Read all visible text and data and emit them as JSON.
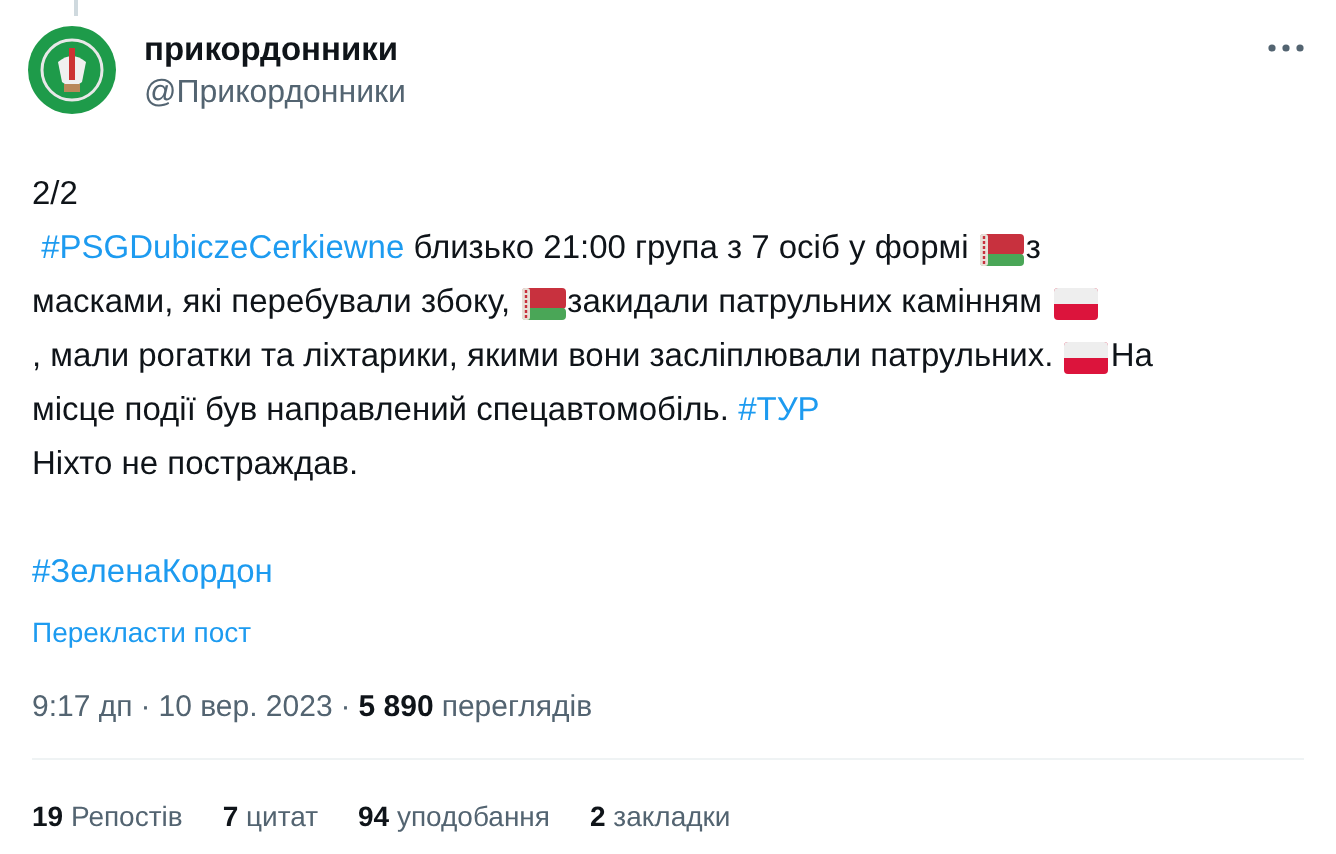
{
  "author": {
    "name": "прикордонники",
    "handle": "@Прикордонники"
  },
  "body": {
    "lines": [
      [
        {
          "kind": "text",
          "text": "2/2"
        }
      ],
      [
        {
          "kind": "hashtag",
          "text": " #PSGDubiczeCerkiewne"
        },
        {
          "kind": "text",
          "text": " близько 21:00 група з 7 осіб у формі "
        },
        {
          "kind": "by_flag"
        },
        {
          "kind": "text",
          "text": "з"
        }
      ],
      [
        {
          "kind": "text",
          "text": "масками, які перебували збоку, "
        },
        {
          "kind": "by_flag"
        },
        {
          "kind": "text",
          "text": "закидали патрульних камінням "
        },
        {
          "kind": "pl_flag"
        }
      ],
      [
        {
          "kind": "text",
          "text": ", мали рогатки та ліхтарики, якими вони засліплювали патрульних. "
        },
        {
          "kind": "pl_flag"
        },
        {
          "kind": "text",
          "text": "На"
        }
      ],
      [
        {
          "kind": "text",
          "text": "місце події був направлений спецавтомобіль. "
        },
        {
          "kind": "hashtag",
          "text": "#ТУР"
        }
      ],
      [
        {
          "kind": "text",
          "text": "Ніхто не постраждав."
        }
      ]
    ],
    "footer_hashtag": "#ЗеленаКордон"
  },
  "translate_link": "Перекласти пост",
  "meta": {
    "time": "9:17 дп",
    "separator_1": "·",
    "date": "10 вер. 2023",
    "separator_2": "·",
    "views_count": "5 890",
    "views_label": "переглядів"
  },
  "stats": [
    {
      "count": "19",
      "label": "Репостів"
    },
    {
      "count": "7",
      "label": "цитат"
    },
    {
      "count": "94",
      "label": "уподобання"
    },
    {
      "count": "2",
      "label": "закладки"
    }
  ]
}
